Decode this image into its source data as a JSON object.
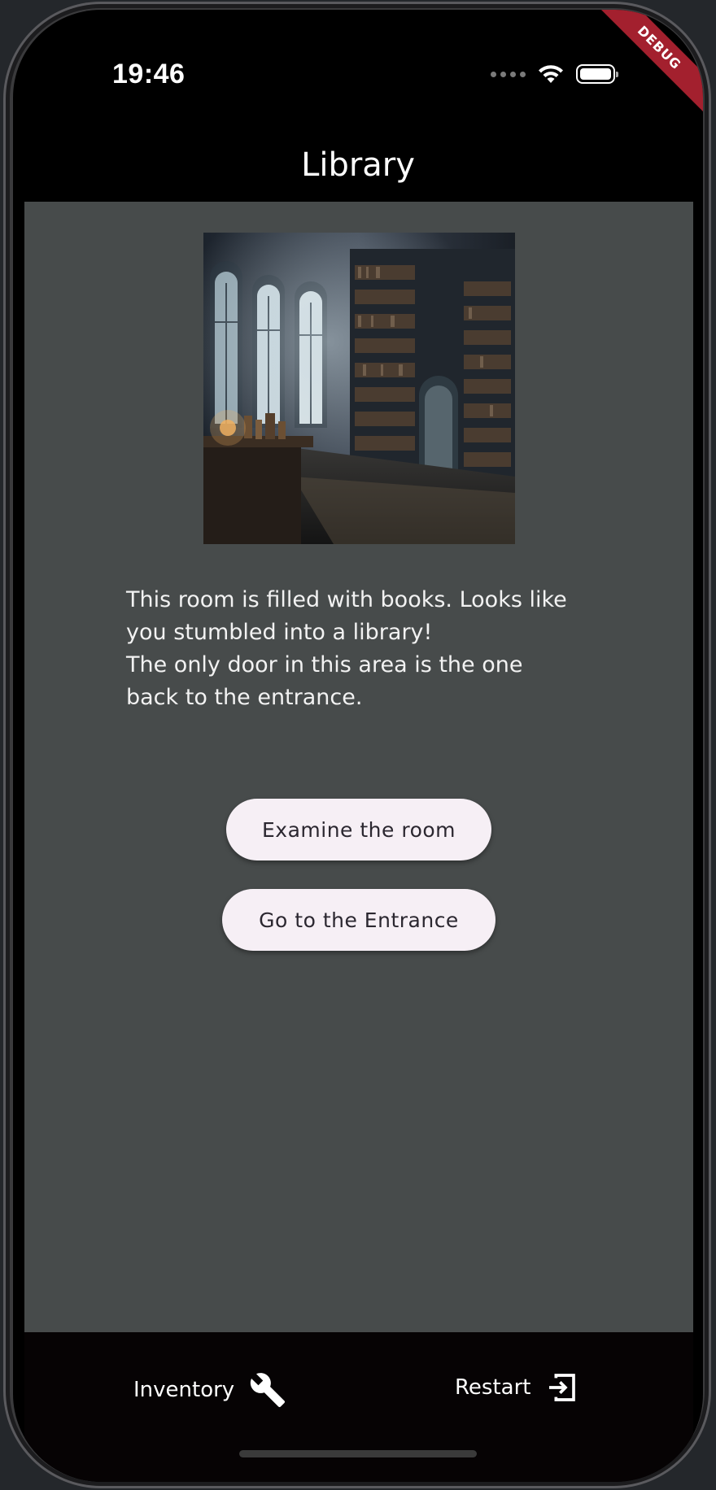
{
  "background": {
    "left_text": "",
    "right_text": ""
  },
  "status_bar": {
    "time": "19:46"
  },
  "debug_banner": "DEBUG",
  "app_bar": {
    "title": "Library"
  },
  "room": {
    "image_alt": "Library room",
    "description_lines": [
      "This room is filled with books. Looks like",
      "you stumbled into a library!",
      "The only door in this area is the one",
      "back to the entrance."
    ]
  },
  "actions": {
    "examine_label": "Examine the room",
    "entrance_label": "Go to the Entrance"
  },
  "bottom_nav": {
    "inventory_label": "Inventory",
    "inventory_icon": "wrench-icon",
    "restart_label": "Restart",
    "restart_icon": "exit-icon"
  },
  "colors": {
    "content_bg": "#474b4b",
    "button_bg": "#f6eff5",
    "bottom_bar_bg": "#060304",
    "debug_banner": "#a3202e"
  }
}
